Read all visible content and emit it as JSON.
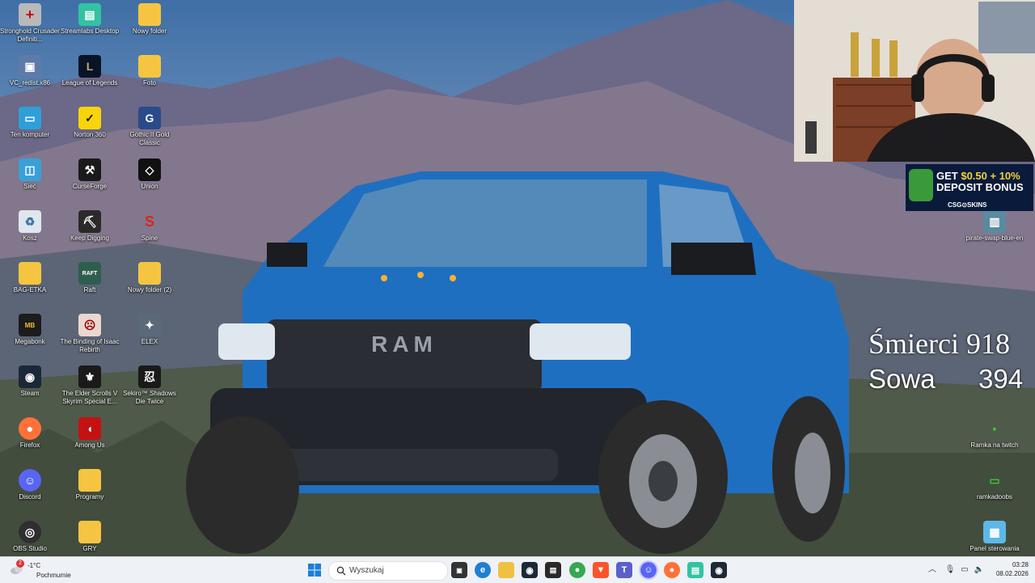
{
  "desktop_icons": {
    "stronghold": "Stronghold Crusader Definiti...",
    "streamlabs": "Streamlabs Desktop",
    "nowy_folder": "Nowy folder",
    "vc_redist": "VC_redist.x86",
    "lol": "League of Legends",
    "foto": "Foto",
    "ten_komputer": "Ten komputer",
    "norton": "Norton 360",
    "gothic": "Gothic II Gold Classic",
    "siec": "Sieć",
    "curseforge": "CurseForge",
    "union": "Union",
    "kosz": "Kosz",
    "keep_digging": "Keep Digging",
    "spine": "Spine",
    "bag_etka": "BAG-ETKA",
    "raft": "Raft",
    "nowy_folder_2": "Nowy folder (2)",
    "megabonk": "Megabonk",
    "isaac": "The Binding of Isaac Rebirth",
    "elex": "ELEX",
    "steam": "Steam",
    "skyrim": "The Elder Scrolls V Skyrim Special E...",
    "sekiro": "Sekiro™ Shadows Die Twice",
    "firefox": "Firefox",
    "among_us": "Among Us",
    "discord": "Discord",
    "programy": "Programy",
    "obs": "OBS Studio",
    "gry": "GRY",
    "pirate_swap": "pirate-swap-blue-en",
    "ramka_twitch": "Ramka na twitch",
    "ramkadoobs": "ramkadoobs",
    "panel": "Panel sterowania"
  },
  "overlay": {
    "ad_line1": "GET ",
    "ad_amount": "$0.50 + 10%",
    "ad_line2": "DEPOSIT BONUS",
    "ad_brand": "CSG⊙SKINS",
    "deaths_label": "Śmierci 918",
    "owl_label": "Sowa",
    "owl_value": "394"
  },
  "taskbar": {
    "notif_count": "2",
    "temperature": "-1°C",
    "condition": "Pochmurnie",
    "search_placeholder": "Wyszukaj",
    "time": "03:28",
    "date": "08.02.2026"
  },
  "colors": {
    "taskbar_bg": "#eef1f6",
    "truck_blue": "#1f6fc0",
    "notif_badge": "#d33333"
  }
}
